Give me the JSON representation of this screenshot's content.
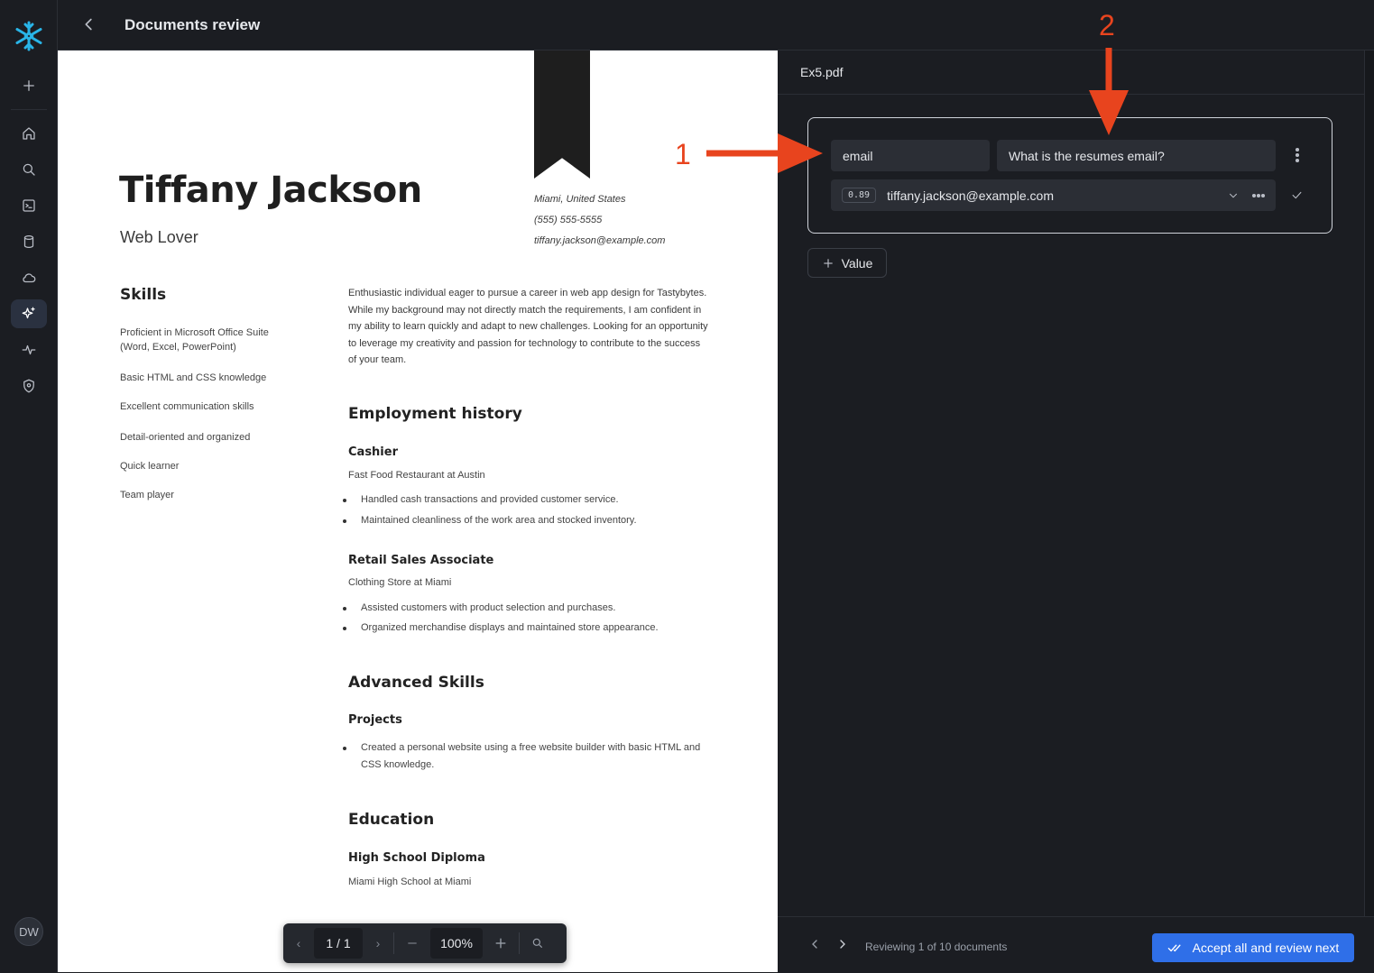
{
  "app": {
    "title": "Documents review",
    "user_initials": "DW"
  },
  "document": {
    "name": "Tiffany Jackson",
    "tagline": "Web Lover",
    "contact": [
      "Miami, United States",
      "(555) 555-5555",
      "tiffany.jackson@example.com"
    ],
    "skills_heading": "Skills",
    "skills": [
      "Proficient in Microsoft Office Suite (Word, Excel, PowerPoint)",
      "Basic HTML and CSS knowledge",
      "Excellent communication skills",
      "Detail-oriented and organized",
      "Quick learner",
      "Team player"
    ],
    "summary": "Enthusiastic individual eager to pursue a career in web app design for Tastybytes. While my background may not directly match the requirements, I am confident in my ability to learn quickly and adapt to new challenges. Looking for an opportunity to leverage my creativity and passion for technology to contribute to the success of your team.",
    "employment_heading": "Employment history",
    "jobs": [
      {
        "title": "Cashier",
        "place": "Fast Food Restaurant at Austin",
        "bullets": [
          "Handled cash transactions and provided customer service.",
          "Maintained cleanliness of the work area and stocked inventory."
        ]
      },
      {
        "title": "Retail Sales Associate",
        "place": "Clothing Store at Miami",
        "bullets": [
          "Assisted customers with product selection and purchases.",
          "Organized merchandise displays and maintained store appearance."
        ]
      }
    ],
    "advanced_heading": "Advanced Skills",
    "projects_title": "Projects",
    "projects_bullet": "Created a personal website using a free website builder with basic HTML and CSS knowledge.",
    "education_heading": "Education",
    "edu_title": "High School Diploma",
    "edu_place": "Miami High School at Miami"
  },
  "pager": {
    "page": "1 / 1",
    "zoom": "100%"
  },
  "panel": {
    "file_name": "Ex5.pdf",
    "field_name": "email",
    "question": "What is the resumes email?",
    "score": "0.89",
    "answer": "tiffany.jackson@example.com",
    "add_value_label": "Value",
    "status": "Reviewing 1 of 10 documents",
    "accept_label": "Accept all and review next"
  },
  "annotations": {
    "one": "1",
    "two": "2"
  },
  "colors": {
    "accent": "#2f6fe8",
    "annotation": "#e8441e",
    "brand": "#29b5e8"
  }
}
